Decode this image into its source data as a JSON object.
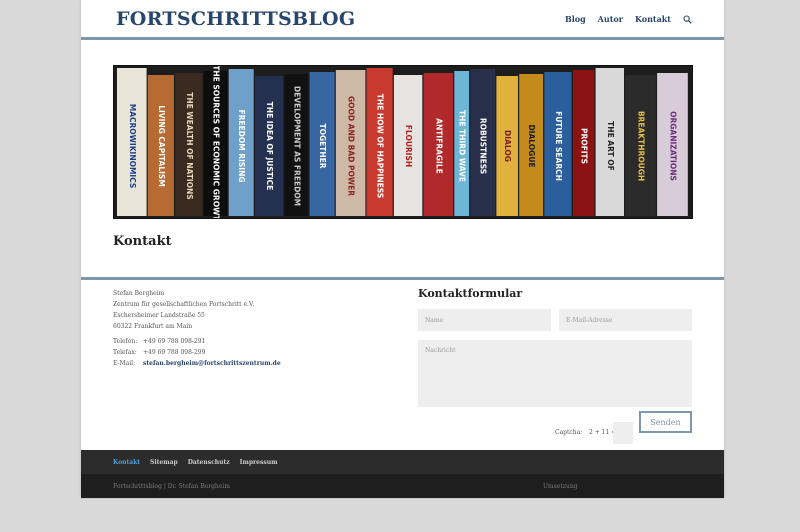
{
  "header": {
    "logo": "FORTSCHRITTSBLOG",
    "nav": [
      "Blog",
      "Autor",
      "Kontakt"
    ],
    "search_icon": "search-icon",
    "accent_color": "#7d97ad",
    "brand_color": "#28456b"
  },
  "banner": {
    "spines": [
      {
        "title": "MACROWIKINOMICS",
        "color": "#e8e4d8",
        "text": "#1a3f8a"
      },
      {
        "title": "LIVING CAPITALISM",
        "color": "#b76a32",
        "text": "#ffffff"
      },
      {
        "title": "THE WEALTH OF NATIONS",
        "color": "#3b2a1f",
        "text": "#e8d9b8"
      },
      {
        "title": "THE SOURCES OF ECONOMIC GROWTH",
        "color": "#0d0d0d",
        "text": "#ffffff"
      },
      {
        "title": "FREEDOM RISING",
        "color": "#6fa0c9",
        "text": "#ffffff"
      },
      {
        "title": "THE IDEA OF JUSTICE",
        "color": "#23304f",
        "text": "#ffffff"
      },
      {
        "title": "DEVELOPMENT AS FREEDOM",
        "color": "#111111",
        "text": "#cccccc"
      },
      {
        "title": "TOGETHER",
        "color": "#3766a3",
        "text": "#ffffff"
      },
      {
        "title": "GOOD AND BAD POWER",
        "color": "#cdb9a5",
        "text": "#8b1e1e"
      },
      {
        "title": "THE HOW OF HAPPINESS",
        "color": "#c93a2e",
        "text": "#ffffff"
      },
      {
        "title": "FLOURISH",
        "color": "#e7e3e0",
        "text": "#b51c1c"
      },
      {
        "title": "ANTIFRAGILE",
        "color": "#b1292a",
        "text": "#ffffff"
      },
      {
        "title": "THE THIRD WAVE",
        "color": "#6db6d6",
        "text": "#ffffff"
      },
      {
        "title": "ROBUSTNESS",
        "color": "#272f4a",
        "text": "#ffffff"
      },
      {
        "title": "DIALOG",
        "color": "#e0b13d",
        "text": "#7a1a1a"
      },
      {
        "title": "DIALOGUE",
        "color": "#c48b1c",
        "text": "#1a1a1a"
      },
      {
        "title": "FUTURE SEARCH",
        "color": "#2a5e9d",
        "text": "#ffffff"
      },
      {
        "title": "PROFITS",
        "color": "#8b1212",
        "text": "#ffffff"
      },
      {
        "title": "THE ART OF",
        "color": "#d9d9d9",
        "text": "#222222"
      },
      {
        "title": "BREAKTHROUGH",
        "color": "#2b2b2b",
        "text": "#e3c04a"
      },
      {
        "title": "ORGANIZATIONS",
        "color": "#d8ccd8",
        "text": "#6a2a7a"
      }
    ]
  },
  "page_title": "Kontakt",
  "address": {
    "lines": [
      "Stefan Bergheim",
      "Zentrum für gesellschaftlichen Fortschritt e.V.",
      "Eschersheimer Landstraße 55",
      "60322 Frankfurt am Main"
    ],
    "phone_label": "Telefon:",
    "phone": "+49 69 788 098-291",
    "fax_label": "Telefax:",
    "fax": "+49 69 788 098-299",
    "email_label": "E-Mail:",
    "email": "stefan.bergheim@fortschrittszentrum.de"
  },
  "form": {
    "title": "Kontaktformular",
    "name_placeholder": "Name",
    "email_placeholder": "E-Mail-Adresse",
    "message_placeholder": "Nachricht",
    "captcha_label": "Captcha:",
    "captcha_expr": "2 + 11 =",
    "send_label": "Senden"
  },
  "footer": {
    "nav": [
      "Kontakt",
      "Sitemap",
      "Datenschutz",
      "Impressum"
    ],
    "active_color": "#4f9fd6",
    "credit": "Fortschrittsblog | Dr. Stefan Bergheim",
    "implementation": "Umsetzung"
  }
}
